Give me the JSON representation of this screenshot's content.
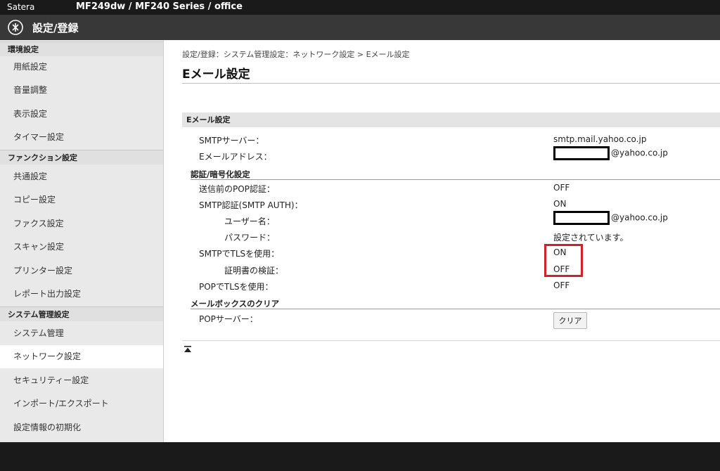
{
  "topbar": {
    "brand": "Satera",
    "model": "MF249dw / MF240 Series / office"
  },
  "header": {
    "title": "設定/登録"
  },
  "sidebar": {
    "sections": [
      {
        "title": "環境設定",
        "items": [
          "用紙設定",
          "音量調整",
          "表示設定",
          "タイマー設定"
        ]
      },
      {
        "title": "ファンクション設定",
        "items": [
          "共通設定",
          "コピー設定",
          "ファクス設定",
          "スキャン設定",
          "プリンター設定",
          "レポート出力設定"
        ]
      },
      {
        "title": "システム管理設定",
        "items": [
          "システム管理",
          "ネットワーク設定",
          "セキュリティー設定",
          "インポート/エクスポート",
          "設定情報の初期化"
        ]
      }
    ],
    "active_item": "ネットワーク設定"
  },
  "main": {
    "breadcrumb": "設定/登録：システム管理設定：ネットワーク設定 > Eメール設定",
    "title": "Eメール設定",
    "group_title": "Eメール設定",
    "smtp_server_label": "SMTPサーバー：",
    "smtp_server_value": "smtp.mail.yahoo.co.jp",
    "email_label": "Eメールアドレス：",
    "email_domain": "@yahoo.co.jp",
    "auth_section_title": "認証/暗号化設定",
    "pop_before_label": "送信前のPOP認証：",
    "pop_before_value": "OFF",
    "smtp_auth_label": "SMTP認証(SMTP AUTH)：",
    "smtp_auth_value": "ON",
    "username_label": "ユーザー名：",
    "username_domain": "@yahoo.co.jp",
    "password_label": "パスワード：",
    "password_value": "設定されています。",
    "smtp_tls_label": "SMTPでTLSを使用：",
    "smtp_tls_value": "ON",
    "cert_verify_label": "証明書の検証：",
    "cert_verify_value": "OFF",
    "pop_tls_label": "POPでTLSを使用：",
    "pop_tls_value": "OFF",
    "mailbox_section_title": "メールボックスのクリア",
    "pop_server_label": "POPサーバー：",
    "clear_button": "クリア"
  },
  "colors": {
    "highlight": "#d0202a",
    "header_bg": "#383838",
    "topbar_bg": "#1a1a1a"
  }
}
